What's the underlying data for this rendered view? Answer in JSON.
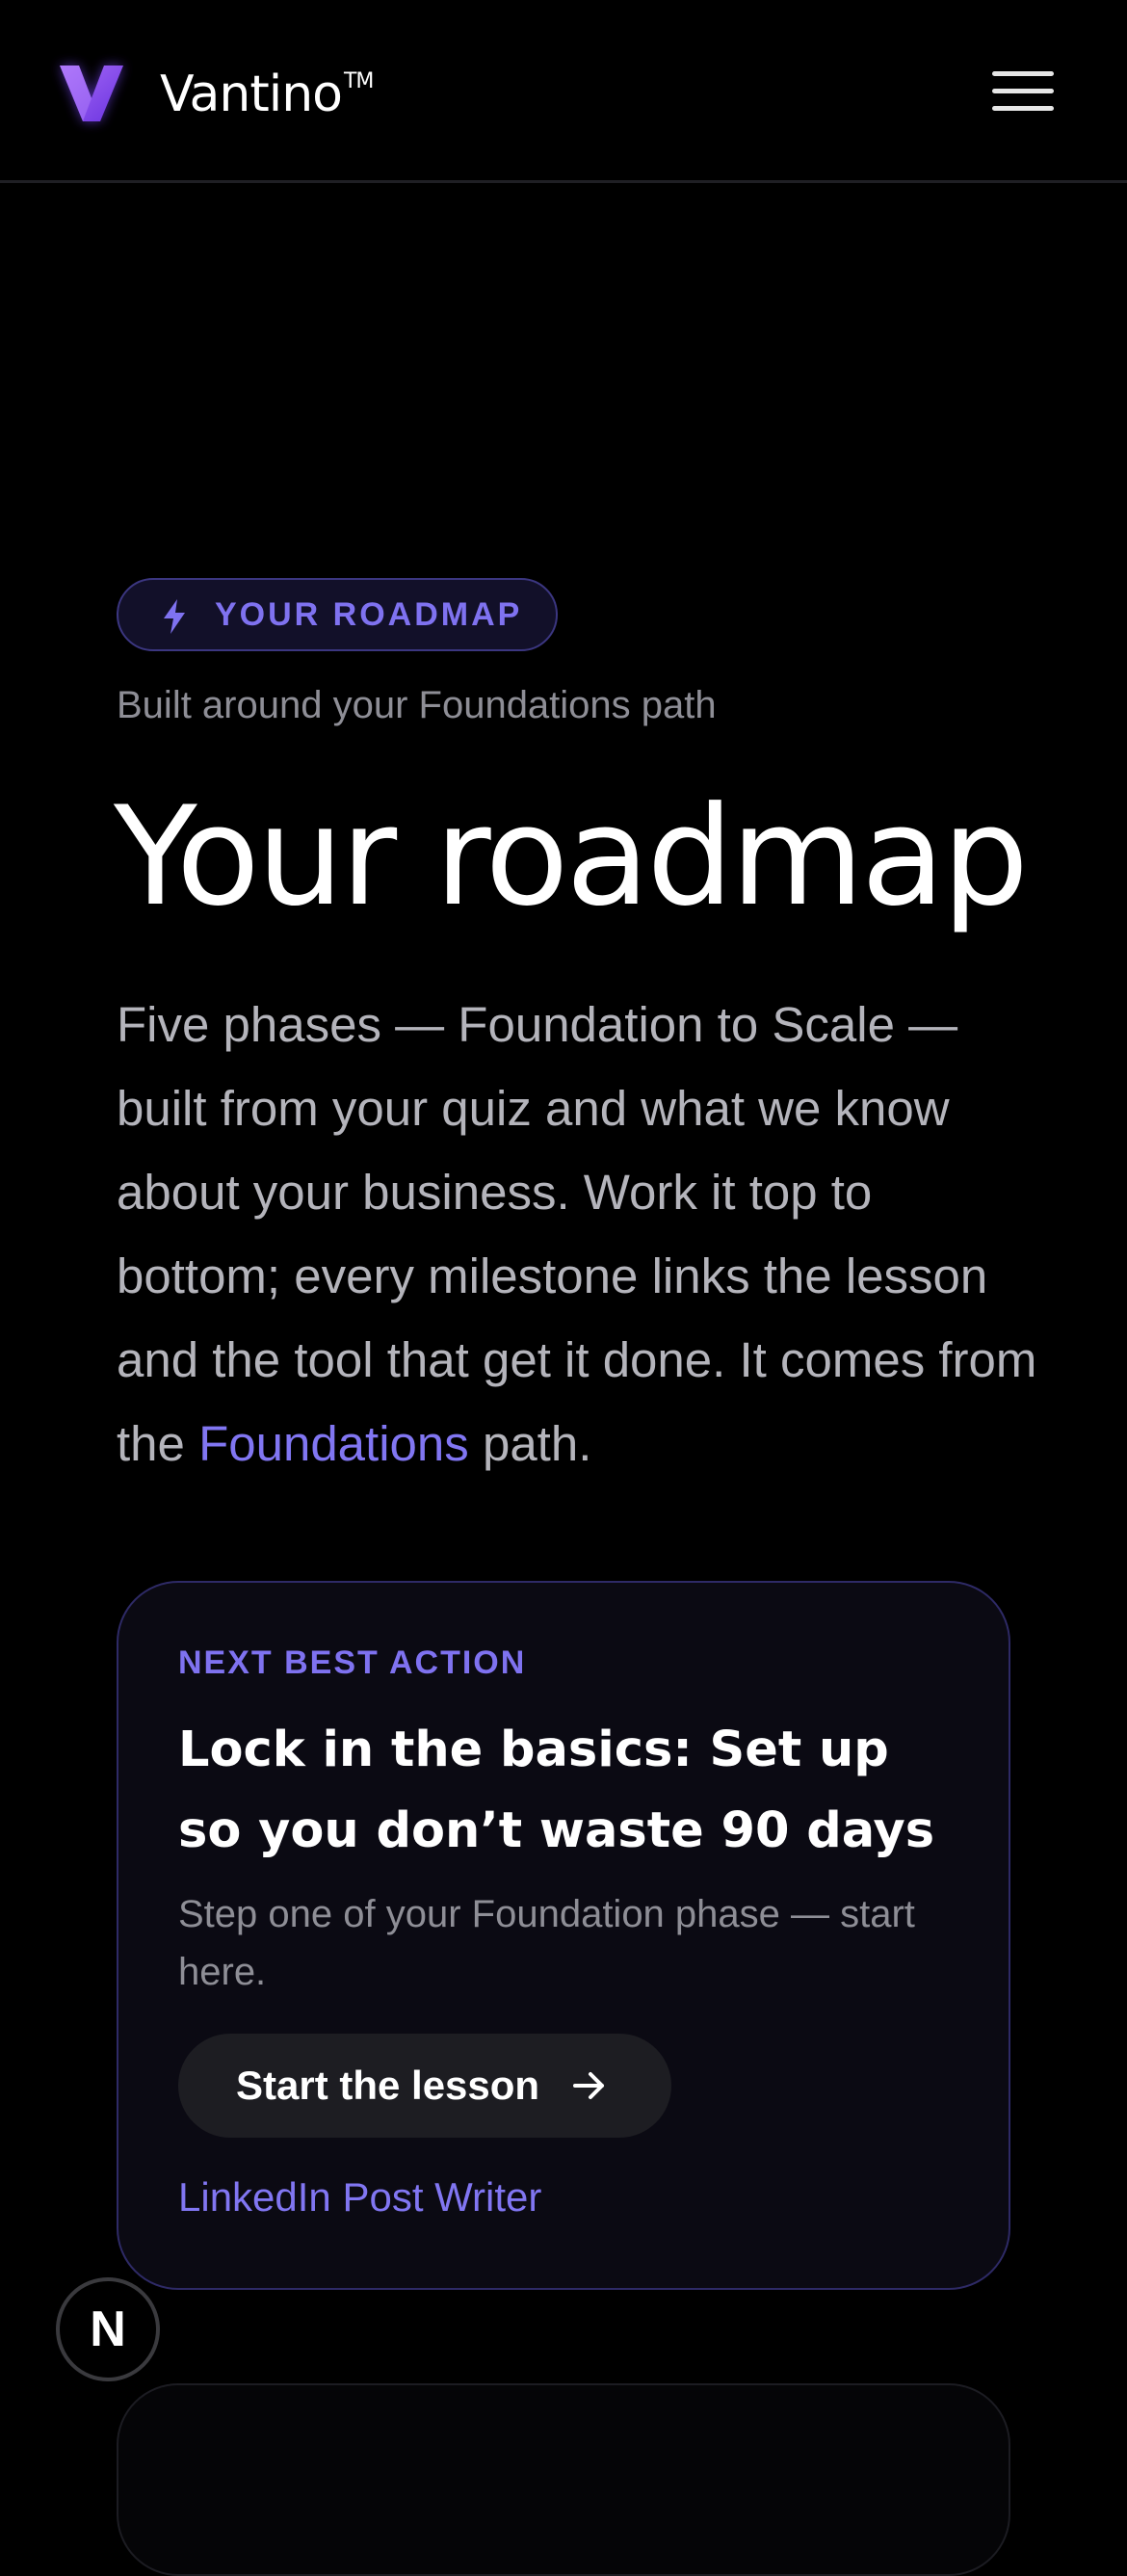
{
  "header": {
    "brand": "Vantino",
    "trademark": "TM",
    "logo_icon": "v-logo-icon",
    "menu_icon": "hamburger-menu-icon"
  },
  "hero": {
    "eyebrow": "YOUR ROADMAP",
    "eyebrow_icon": "lightning-bolt-icon",
    "subtitle": "Built around your Foundations path",
    "title": "Your roadmap",
    "intro_text": "Five phases — Foundation to Scale — built from your quiz and what we know about your business. Work it top to bottom; every milestone links the lesson and the tool that get it done. It comes from the ",
    "intro_link": "Foundations",
    "intro_suffix": " path."
  },
  "next_action": {
    "eyebrow": "NEXT BEST ACTION",
    "title": "Lock in the basics: Set up so you don’t waste 90 days",
    "description": "Step one of your Foundation phase — start here.",
    "button_label": "Start the lesson",
    "button_icon": "arrow-right-icon",
    "tool_link": "LinkedIn Post Writer"
  },
  "badge": {
    "letter": "N"
  },
  "colors": {
    "background": "#000000",
    "accent": "#8176f2",
    "muted_text": "#8e8e96",
    "body_text": "#b4b4bb"
  }
}
